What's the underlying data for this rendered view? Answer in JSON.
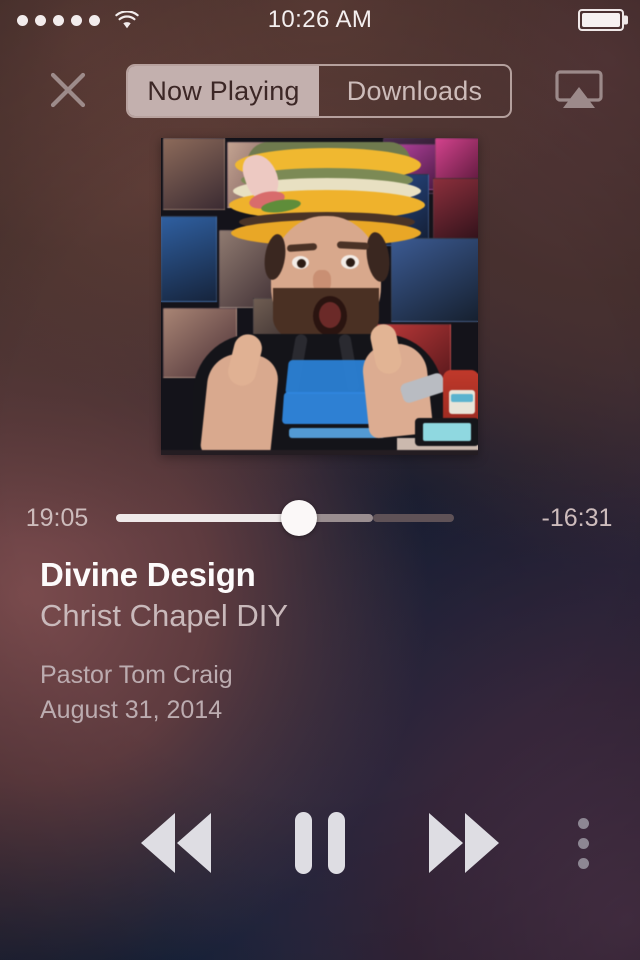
{
  "status_bar": {
    "signal_dots_total": 5,
    "signal_dots_filled": 5,
    "wifi_icon": "wifi-icon",
    "time": "10:26 AM",
    "battery_icon": "battery-icon",
    "battery_level_percent": 100
  },
  "top_bar": {
    "close_icon": "close-icon",
    "airplay_icon": "airplay-icon",
    "segments": [
      {
        "label": "Now Playing",
        "selected": true
      },
      {
        "label": "Downloads",
        "selected": false
      }
    ]
  },
  "artwork": {
    "alt": "Man wearing a plush hamburger hat giving two thumbs up in front of a wall of photographs",
    "name": "album-artwork"
  },
  "player": {
    "elapsed": "19:05",
    "remaining": "-16:31",
    "progress_percent": 54,
    "buffered_percent": 76
  },
  "track": {
    "title": "Divine Design",
    "subtitle": "Christ Chapel DIY",
    "speaker": "Pastor Tom Craig",
    "date": "August 31, 2014"
  },
  "controls": {
    "rewind_icon": "rewind-icon",
    "playpause_icon": "pause-icon",
    "forward_icon": "fast-forward-icon",
    "more_icon": "more-vertical-icon"
  },
  "colors": {
    "background_top_left": "#4a332f",
    "background_bottom_center": "#15213a",
    "background_bottom_right": "#36263a",
    "segment_selected_fill": "#c3b0ae",
    "segment_selected_text": "#3c2726",
    "control_tint": "#dedde3",
    "text_primary": "#fdfbfb",
    "text_secondary": "#c9b9bb"
  }
}
